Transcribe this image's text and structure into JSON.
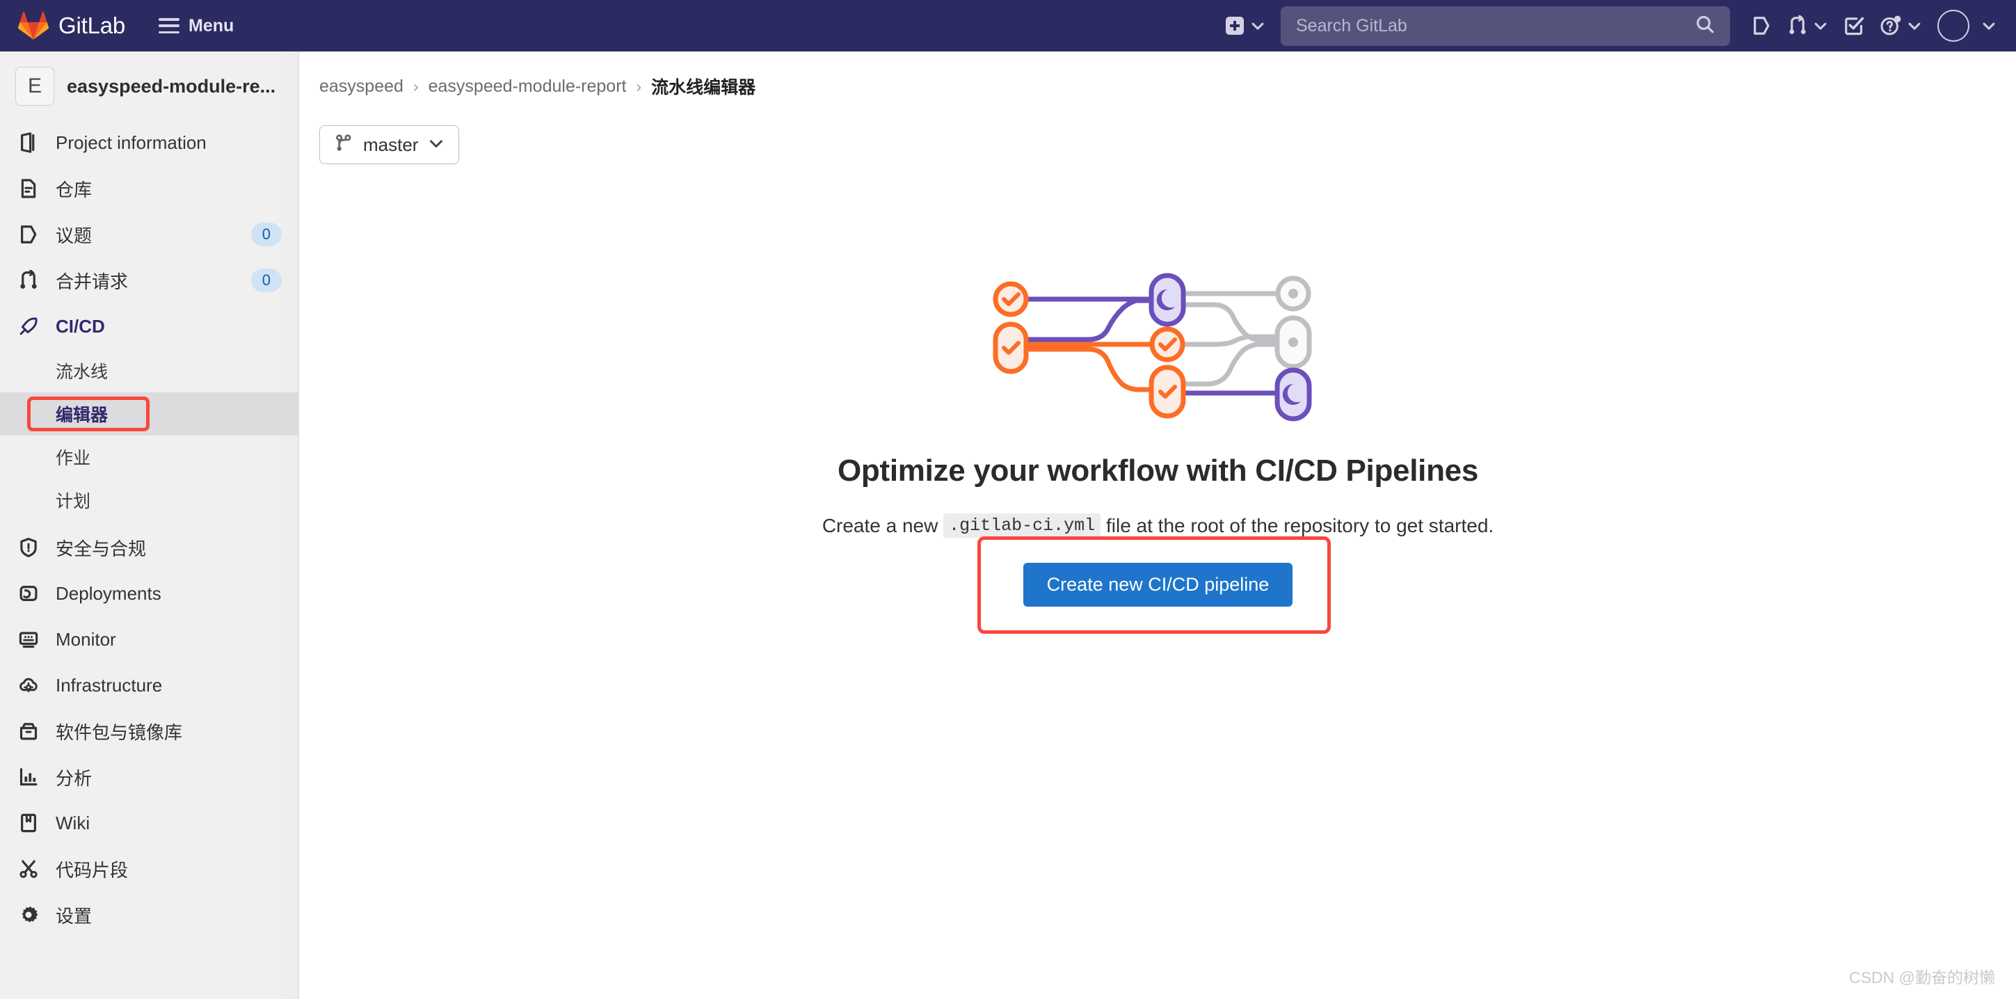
{
  "navbar": {
    "brand": "GitLab",
    "menu_label": "Menu",
    "search": {
      "placeholder": "Search GitLab",
      "value": ""
    },
    "icons": [
      {
        "name": "new-item-plus-icon",
        "label": "Create new..."
      },
      {
        "name": "issues-icon",
        "label": "Issues"
      },
      {
        "name": "merge-requests-icon",
        "label": "Merge requests"
      },
      {
        "name": "todos-icon",
        "label": "To-Do List"
      },
      {
        "name": "help-question-icon",
        "label": "Help"
      },
      {
        "name": "user-avatar-icon",
        "label": "User menu"
      }
    ]
  },
  "sidebar": {
    "project": {
      "initial": "E",
      "name": "easyspeed-module-re..."
    },
    "items": [
      {
        "label": "Project information",
        "icon": "project-info-icon",
        "badge": null,
        "active": false
      },
      {
        "label": "仓库",
        "icon": "repository-icon",
        "badge": null,
        "active": false
      },
      {
        "label": "议题",
        "icon": "issues-icon",
        "badge": "0",
        "active": false
      },
      {
        "label": "合并请求",
        "icon": "merge-request-icon",
        "badge": "0",
        "active": false
      },
      {
        "label": "CI/CD",
        "icon": "rocket-icon",
        "badge": null,
        "active": true
      },
      {
        "label": "安全与合规",
        "icon": "shield-icon",
        "badge": null,
        "active": false
      },
      {
        "label": "Deployments",
        "icon": "deployments-icon",
        "badge": null,
        "active": false
      },
      {
        "label": "Monitor",
        "icon": "monitor-icon",
        "badge": null,
        "active": false
      },
      {
        "label": "Infrastructure",
        "icon": "cloud-gear-icon",
        "badge": null,
        "active": false
      },
      {
        "label": "软件包与镜像库",
        "icon": "package-icon",
        "badge": null,
        "active": false
      },
      {
        "label": "分析",
        "icon": "analytics-chart-icon",
        "badge": null,
        "active": false
      },
      {
        "label": "Wiki",
        "icon": "book-icon",
        "badge": null,
        "active": false
      },
      {
        "label": "代码片段",
        "icon": "snippets-scissors-icon",
        "badge": null,
        "active": false
      },
      {
        "label": "设置",
        "icon": "gear-icon",
        "badge": null,
        "active": false
      }
    ],
    "cicd_sub_items": [
      {
        "label": "流水线",
        "current": false
      },
      {
        "label": "编辑器",
        "current": true
      },
      {
        "label": "作业",
        "current": false
      },
      {
        "label": "计划",
        "current": false
      }
    ]
  },
  "breadcrumb": {
    "items": [
      "easyspeed",
      "easyspeed-module-report"
    ],
    "separator": "›",
    "current": "流水线编辑器"
  },
  "branch_selector": {
    "value": "master",
    "icon": "branch-icon"
  },
  "empty_state": {
    "title": "Optimize your workflow with CI/CD Pipelines",
    "desc_before": "Create a new ",
    "desc_code": ".gitlab-ci.yml",
    "desc_after": " file at the root of the repository to get started.",
    "cta_label": "Create new CI/CD pipeline"
  },
  "colors": {
    "navbar_bg": "#2b2b61",
    "accent_blue": "#1f75cb",
    "annotation_red": "#f8483c",
    "active_nav_purple": "#2f2a6b",
    "badge_bg": "#cfe3f7",
    "badge_text": "#1a5ba8",
    "pipeline_orange": "#fc6d26",
    "pipeline_purple": "#6b4fbb",
    "pipeline_gray": "#bfbfc3"
  },
  "watermark": "CSDN @勤奋的树懒"
}
